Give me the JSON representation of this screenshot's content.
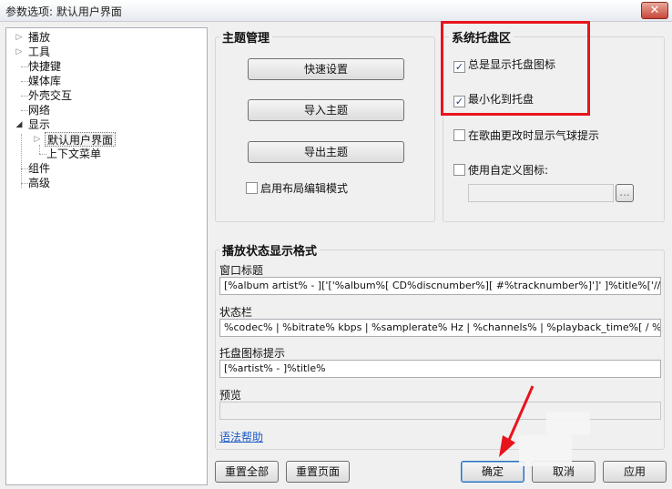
{
  "window": {
    "title": "参数选项: 默认用户界面",
    "close_glyph": "✕"
  },
  "tree": {
    "items": [
      {
        "label": "播放",
        "expandable": true
      },
      {
        "label": "工具",
        "expandable": true
      },
      {
        "label": "快捷键"
      },
      {
        "label": "媒体库"
      },
      {
        "label": "外壳交互"
      },
      {
        "label": "网络"
      },
      {
        "label": "显示",
        "expanded": true
      },
      {
        "label": "默认用户界面",
        "selected": true,
        "expandable": true
      },
      {
        "label": "上下文菜单"
      },
      {
        "label": "组件"
      },
      {
        "label": "高级"
      }
    ]
  },
  "theme": {
    "title": "主题管理",
    "quick_setup": "快速设置",
    "import": "导入主题",
    "export": "导出主题",
    "layout_edit": "启用布局编辑模式"
  },
  "tray": {
    "title": "系统托盘区",
    "always_show": "总是显示托盘图标",
    "minimize": "最小化到托盘",
    "balloon": "在歌曲更改时显示气球提示",
    "custom_icon": "使用自定义图标:",
    "browse": "..."
  },
  "format": {
    "title": "播放状态显示格式",
    "window_title_label": "窗口标题",
    "window_title_value": "[%album artist% - ]['['%album%[ CD%discnumber%][ #%tracknumber%]']' ]%title%['//' %track a",
    "status_label": "状态栏",
    "status_value": "%codec% | %bitrate% kbps | %samplerate% Hz | %channels% | %playback_time%[ / %length%",
    "tray_label": "托盘图标提示",
    "tray_value": "[%artist% - ]%title%",
    "preview_label": "预览",
    "syntax_help": "语法帮助"
  },
  "buttons": {
    "reset_all": "重置全部",
    "reset_page": "重置页面",
    "ok": "确定",
    "cancel": "取消",
    "apply": "应用"
  },
  "colors": {
    "highlight": "#e8141c",
    "link": "#1b59c8"
  }
}
